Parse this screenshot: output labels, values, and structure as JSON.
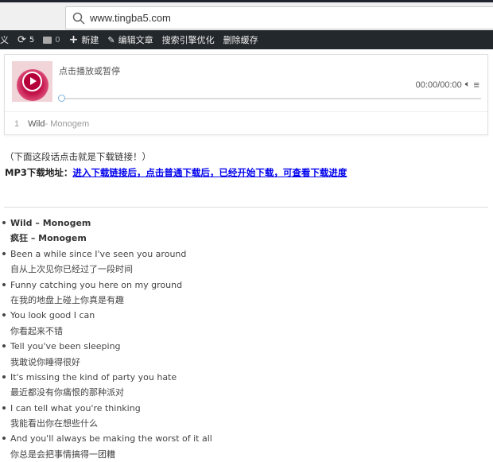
{
  "browser": {
    "url": "www.tingba5.com"
  },
  "adminbar": {
    "partial_item": "义",
    "updates_count": "5",
    "comments_count": "0",
    "new_label": "新建",
    "edit_label": "编辑文章",
    "seo_label": "搜索引擎优化",
    "cache_label": "删除缓存"
  },
  "player": {
    "title": "点击播放或暂停",
    "time": "00:00/00:00",
    "progress": 0,
    "playlist": [
      {
        "index": "1",
        "title": "Wild",
        "artist": " - Monogem"
      }
    ]
  },
  "download": {
    "note": "（下面这段话点击就是下载链接！）",
    "label": "MP3下载地址：",
    "link_text": "进入下载链接后，点击普通下载后，已经开始下载，可查看下载进度"
  },
  "lyrics": [
    {
      "en": "Wild – Monogem",
      "zh": "疯狂 – Monogem",
      "bold": true
    },
    {
      "en": "Been a while since I've seen you around",
      "zh": "自从上次见你已经过了一段时间"
    },
    {
      "en": "Funny catching you here on my ground",
      "zh": "在我的地盘上碰上你真是有趣"
    },
    {
      "en": "You look good I can",
      "zh": "你看起来不错"
    },
    {
      "en": "Tell you've been sleeping",
      "zh": "我敢说你睡得很好"
    },
    {
      "en": "It's missing the kind of party you hate",
      "zh": "最近都没有你痛恨的那种派对"
    },
    {
      "en": "I can tell what you're thinking",
      "zh": "我能看出你在想些什么"
    },
    {
      "en": "And you'll always be making the worst of it all",
      "zh": "你总是会把事情搞得一团糟"
    }
  ]
}
